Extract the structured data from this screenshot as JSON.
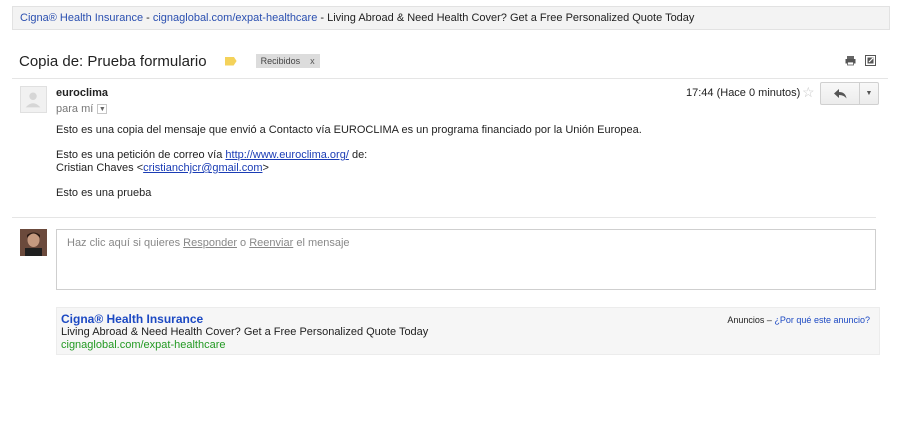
{
  "top_ad": {
    "title": "Cigna® Health Insurance",
    "separator": " - ",
    "url": "cignaglobal.com/expat-healthcare",
    "separator2": " - ",
    "text": "Living Abroad & Need Health Cover? Get a Free Personalized Quote Today"
  },
  "subject": "Copia de: Prueba formulario",
  "label": {
    "name": "Recibidos",
    "remove": "x"
  },
  "toolbar_icons": [
    "print-icon",
    "new-window-icon"
  ],
  "message": {
    "sender": "euroclima",
    "to": "para mí",
    "time": "17:44 (Hace 0 minutos)",
    "body_line1": "Esto es una copia del mensaje que envió a Contacto vía EUROCLIMA es un programa financiado por la Unión Europea.",
    "body_line2_prefix": "Esto es una petición de correo vía ",
    "body_link": "http://www.euroclima.org/",
    "body_line2_suffix": " de:",
    "body_line3_name": "Cristian Chaves <",
    "body_line3_email": "cristianchjcr@gmail.com",
    "body_line3_close": ">",
    "body_line4": "Esto es una prueba"
  },
  "reply_box": {
    "prefix": "Haz clic aquí si quieres ",
    "reply": "Responder",
    "middle": " o ",
    "forward": "Reenviar",
    "suffix": " el mensaje"
  },
  "bottom_ad": {
    "title": "Cigna® Health Insurance",
    "text": "Living Abroad & Need Health Cover? Get a Free Personalized Quote Today",
    "url": "cignaglobal.com/expat-healthcare",
    "meta_prefix": "Anuncios – ",
    "meta_link": "¿Por qué este anuncio?"
  }
}
